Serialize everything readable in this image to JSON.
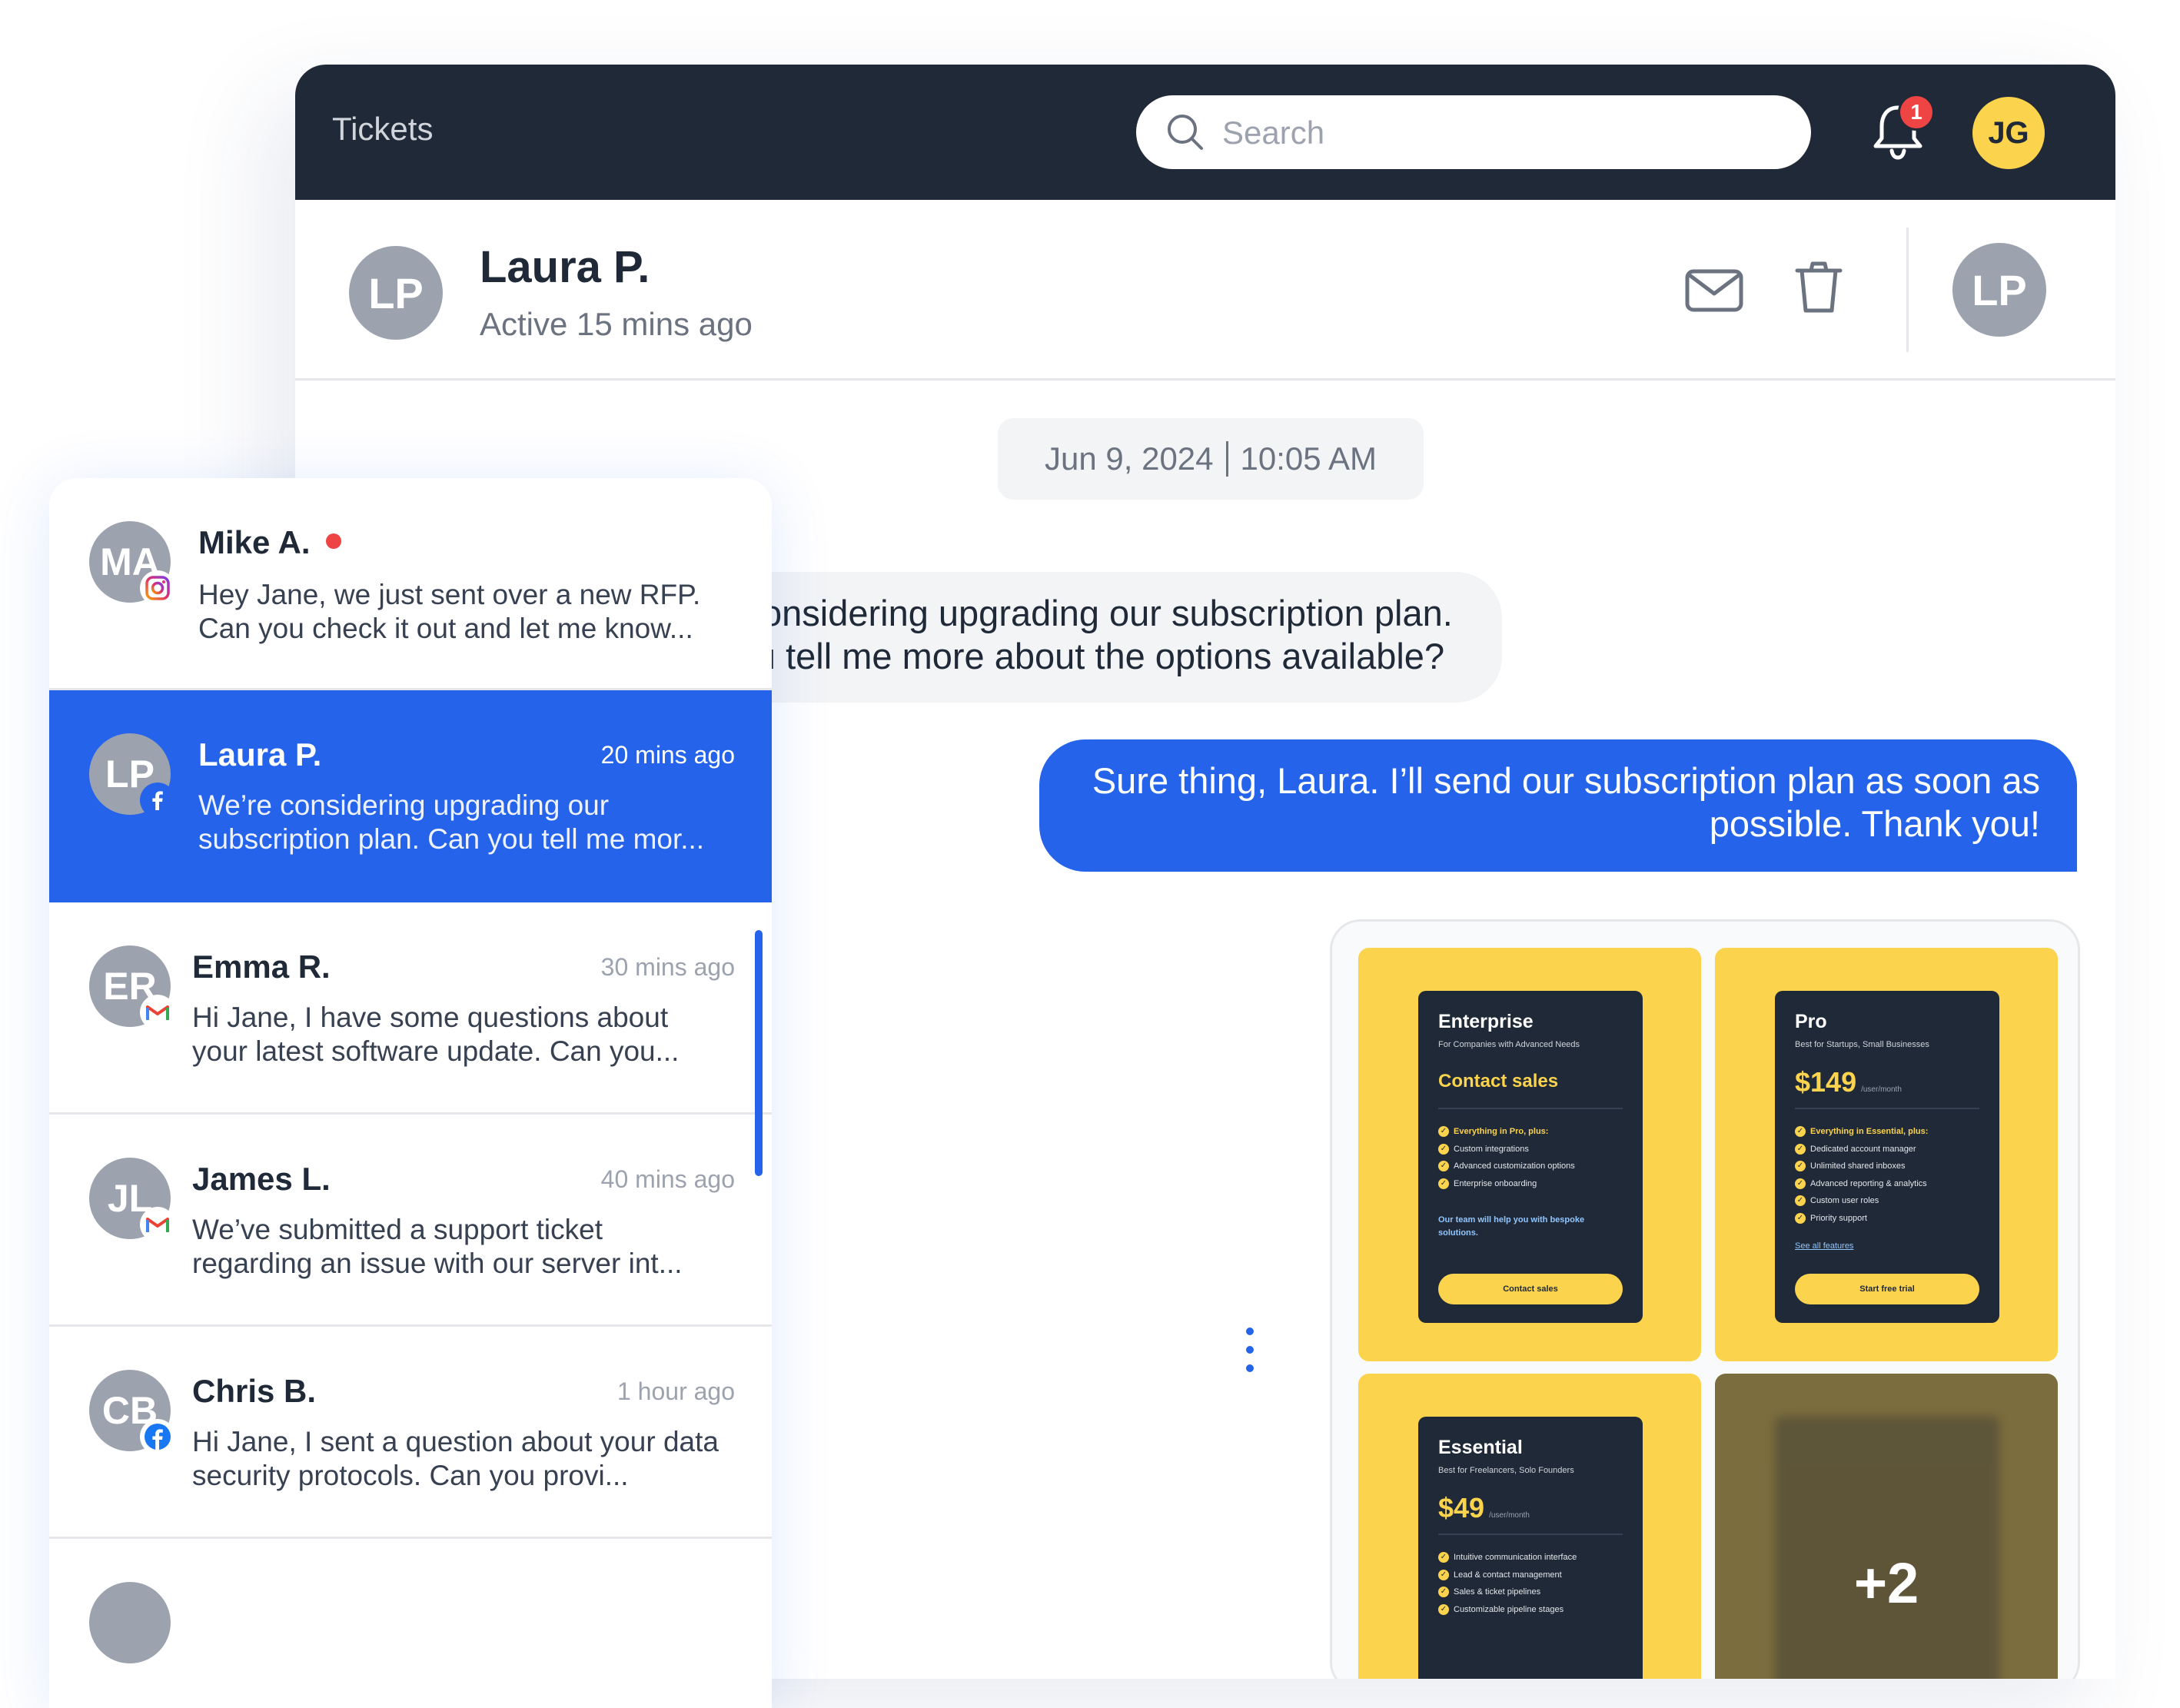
{
  "app": {
    "title": "Tickets",
    "search_placeholder": "Search",
    "notification_count": "1",
    "user_initials": "JG"
  },
  "contact": {
    "initials": "LP",
    "name": "Laura P.",
    "status": "Active 15 mins ago"
  },
  "thread": {
    "date": "Jun 9, 2024",
    "time": "10:05 AM",
    "incoming_message": "We're considering upgrading our subscription plan. Can you tell me more about the options available?",
    "outgoing_message": "Sure thing, Laura. I’ll send our subscription plan as soon as possible. Thank you!"
  },
  "attachments": {
    "more_count": "+2",
    "plans": [
      {
        "name": "Enterprise",
        "subtitle": "For Companies with Advanced Needs",
        "price": "Contact sales",
        "features_heading": "Everything in Pro, plus:",
        "features": [
          "Custom integrations",
          "Advanced customization options",
          "Enterprise onboarding"
        ],
        "note": "Our team will help you with bespoke solutions.",
        "button": "Contact sales"
      },
      {
        "name": "Pro",
        "subtitle": "Best for Startups, Small Businesses",
        "price": "$149",
        "price_unit": "/user/month",
        "features_heading": "Everything in Essential, plus:",
        "features": [
          "Dedicated account manager",
          "Unlimited shared inboxes",
          "Advanced reporting & analytics",
          "Custom user roles",
          "Priority support"
        ],
        "link": "See all features",
        "button": "Start free trial"
      },
      {
        "name": "Essential",
        "subtitle": "Best for Freelancers, Solo Founders",
        "price": "$49",
        "price_unit": "/user/month",
        "features": [
          "Intuitive communication interface",
          "Lead & contact management",
          "Sales & ticket pipelines",
          "Customizable pipeline stages"
        ]
      }
    ]
  },
  "conversations": [
    {
      "initials": "MA",
      "name": "Mike A.",
      "time": "",
      "preview": "Hey Jane, we just sent over a new RFP. Can you check it out and let me know...",
      "source": "instagram",
      "unread": true
    },
    {
      "initials": "LP",
      "name": "Laura P.",
      "time": "20 mins ago",
      "preview": "We’re considering upgrading our subscription plan. Can you tell me mor...",
      "source": "facebook",
      "active": true
    },
    {
      "initials": "ER",
      "name": "Emma R.",
      "time": "30 mins ago",
      "preview": "Hi Jane, I have some questions about your latest software update. Can you...",
      "source": "gmail"
    },
    {
      "initials": "JL",
      "name": "James L.",
      "time": "40 mins ago",
      "preview": "We’ve submitted a support ticket regarding an issue with our server int...",
      "source": "gmail"
    },
    {
      "initials": "CB",
      "name": "Chris B.",
      "time": "1 hour ago",
      "preview": "Hi Jane, I sent a question about your data security protocols. Can you provi...",
      "source": "facebook"
    }
  ],
  "colors": {
    "topbar": "#1f2937",
    "accent": "#2563eb",
    "plan_yellow": "#fcd34d",
    "unread_red": "#ef4444"
  }
}
